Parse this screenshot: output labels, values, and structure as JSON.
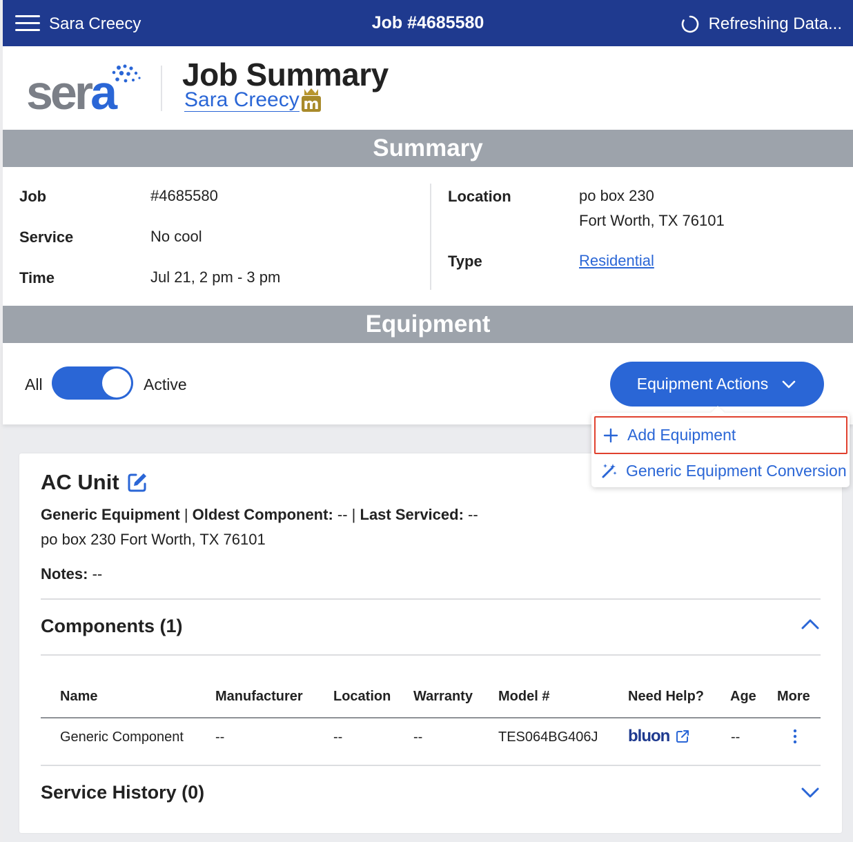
{
  "topbar": {
    "user_name": "Sara Creecy",
    "job_title": "Job #4685580",
    "refresh_text": "Refreshing Data..."
  },
  "header": {
    "logo_text_grey": "ser",
    "logo_text_blue": "a",
    "title": "Job Summary",
    "customer_name": "Sara Creecy",
    "badge_letter": "m"
  },
  "summary": {
    "bar_title": "Summary",
    "job_label": "Job",
    "job_value": "#4685580",
    "service_label": "Service",
    "service_value": "No cool",
    "time_label": "Time",
    "time_value": "Jul 21, 2 pm - 3 pm",
    "location_label": "Location",
    "location_line1": "po box 230",
    "location_line2": "Fort Worth, TX 76101",
    "type_label": "Type",
    "type_value": "Residential"
  },
  "equipment": {
    "bar_title": "Equipment",
    "filter_all": "All",
    "filter_active": "Active",
    "actions_label": "Equipment Actions",
    "menu": {
      "add_equipment": "Add Equipment",
      "generic_conversion": "Generic Equipment Conversion"
    }
  },
  "card": {
    "title": "AC Unit",
    "meta_generic": "Generic Equipment",
    "meta_sep": " | ",
    "meta_oldest_label": "Oldest Component:",
    "meta_oldest_value": " -- ",
    "meta_last_label": "Last Serviced:",
    "meta_last_value": " --",
    "address": "po box 230 Fort Worth, TX 76101",
    "notes_label": "Notes:",
    "notes_value": " --",
    "components_title": "Components (1)",
    "service_history_title": "Service History (0)",
    "columns": {
      "name": "Name",
      "manufacturer": "Manufacturer",
      "location": "Location",
      "warranty": "Warranty",
      "model": "Model #",
      "need_help": "Need Help?",
      "age": "Age",
      "more": "More"
    },
    "row": {
      "name": "Generic Component",
      "manufacturer": "--",
      "location": "--",
      "warranty": "--",
      "model": "TES064BG406J",
      "help_brand": "bluon",
      "age": "--"
    }
  },
  "colors": {
    "topbar": "#1f3a8f",
    "accent": "#2a66d6",
    "section_bar": "#9da3ab",
    "highlight_border": "#e0412e"
  }
}
